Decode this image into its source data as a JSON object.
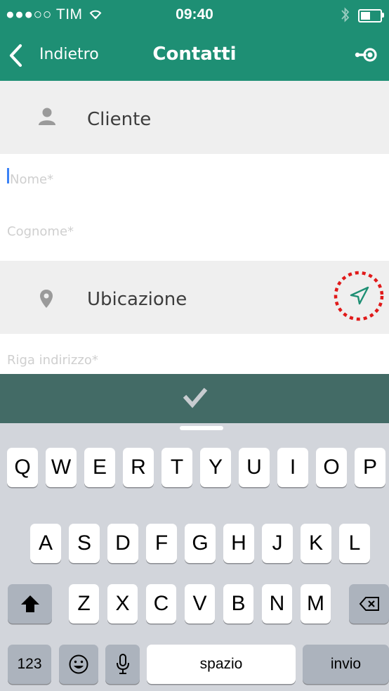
{
  "status_bar": {
    "carrier": "●●●○○ TIM",
    "time": "09:40"
  },
  "nav": {
    "back_label": "Indietro",
    "title": "Contatti"
  },
  "sections": {
    "client": {
      "label": "Cliente",
      "icon": "person-icon"
    },
    "location": {
      "label": "Ubicazione",
      "icon": "location-pin-icon",
      "action_icon": "navigation-arrow-icon"
    }
  },
  "fields": {
    "nome": {
      "placeholder": "Nome*",
      "value": ""
    },
    "cognome": {
      "placeholder": "Cognome*",
      "value": ""
    },
    "indirizzo": {
      "placeholder": "Riga indirizzo*",
      "value": ""
    }
  },
  "keyboard": {
    "row1": [
      "Q",
      "W",
      "E",
      "R",
      "T",
      "Y",
      "U",
      "I",
      "O",
      "P"
    ],
    "row2": [
      "A",
      "S",
      "D",
      "F",
      "G",
      "H",
      "J",
      "K",
      "L"
    ],
    "row3": [
      "Z",
      "X",
      "C",
      "V",
      "B",
      "N",
      "M"
    ],
    "numbers_label": "123",
    "space_label": "spazio",
    "return_label": "invio"
  },
  "colors": {
    "header": "#1e8f74",
    "done_bar": "#436b66",
    "accent": "#1e8f74",
    "highlight": "#e01a1a",
    "keyboard_bg": "#d2d5db"
  }
}
